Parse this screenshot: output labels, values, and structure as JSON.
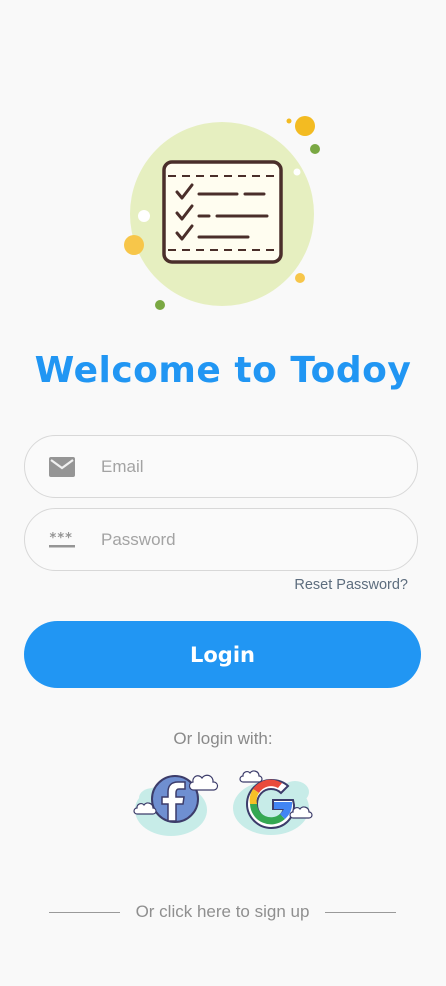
{
  "app": {
    "title": "Welcome to Todoy"
  },
  "form": {
    "email": {
      "placeholder": "Email",
      "value": "",
      "icon": "mail-icon"
    },
    "password": {
      "placeholder": "Password",
      "value": "",
      "icon": "password-icon"
    },
    "reset_label": "Reset Password?",
    "login_label": "Login"
  },
  "social": {
    "label": "Or login with:",
    "providers": [
      {
        "name": "facebook",
        "icon": "facebook-icon"
      },
      {
        "name": "google",
        "icon": "google-icon"
      }
    ]
  },
  "signup": {
    "label": "Or click here to sign up"
  },
  "colors": {
    "accent": "#2196f3",
    "background": "#f9f9f9"
  }
}
